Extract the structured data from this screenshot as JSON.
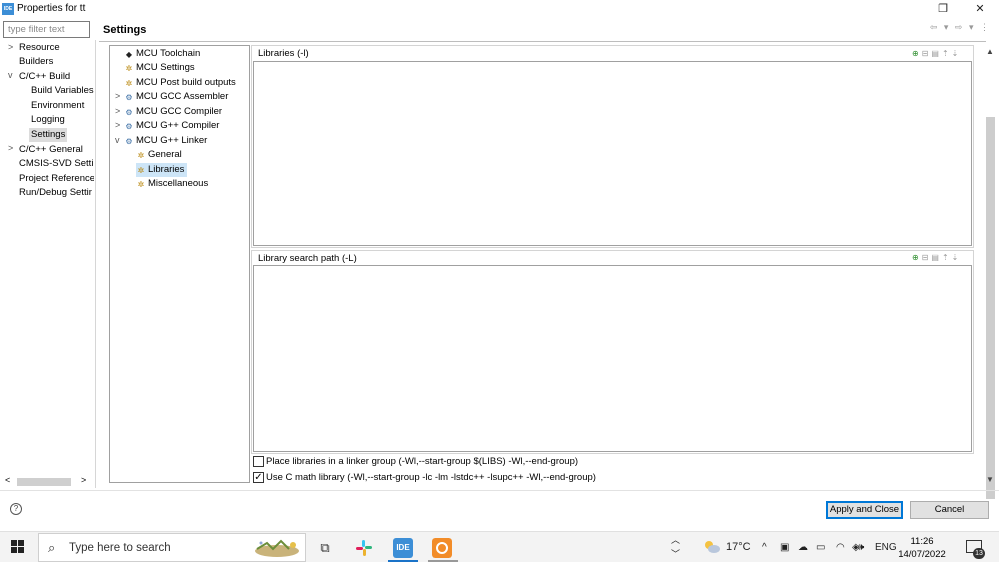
{
  "window": {
    "logo_text": "IDE",
    "title": "Properties for tt",
    "minimize_glyph": "—",
    "restore_glyph": "❐",
    "close_glyph": "✕"
  },
  "nav": {
    "filter_placeholder": "type filter text",
    "items": [
      {
        "label": "Resource",
        "twisty": ">"
      },
      {
        "label": "Builders",
        "twisty": ""
      },
      {
        "label": "C/C++ Build",
        "twisty": "v"
      },
      {
        "label": "Build Variables",
        "twisty": ""
      },
      {
        "label": "Environment",
        "twisty": ""
      },
      {
        "label": "Logging",
        "twisty": ""
      },
      {
        "label": "Settings",
        "twisty": "",
        "selected": true
      },
      {
        "label": "C/C++ General",
        "twisty": ">"
      },
      {
        "label": "CMSIS-SVD Setti",
        "twisty": ""
      },
      {
        "label": "Project Reference",
        "twisty": ""
      },
      {
        "label": "Run/Debug Settir",
        "twisty": ""
      }
    ],
    "scroll_left": "<",
    "scroll_right": ">"
  },
  "page": {
    "title": "Settings",
    "history_icons": "⇦ ▾ ⇨ ▾ ⋮"
  },
  "tool_tree": {
    "items": [
      {
        "label": "MCU Toolchain",
        "twisty": "",
        "icon": "chip-icon"
      },
      {
        "label": "MCU Settings",
        "twisty": "",
        "icon": "cog-icon"
      },
      {
        "label": "MCU Post build outputs",
        "twisty": "",
        "icon": "cog-icon"
      },
      {
        "label": "MCU GCC Assembler",
        "twisty": ">",
        "icon": "gear-icon"
      },
      {
        "label": "MCU GCC Compiler",
        "twisty": ">",
        "icon": "gear-icon"
      },
      {
        "label": "MCU G++ Compiler",
        "twisty": ">",
        "icon": "gear-icon"
      },
      {
        "label": "MCU G++ Linker",
        "twisty": "v",
        "icon": "gear-icon"
      },
      {
        "label": "General",
        "twisty": "",
        "icon": "cog-icon"
      },
      {
        "label": "Libraries",
        "twisty": "",
        "icon": "cog-icon",
        "selected": true
      },
      {
        "label": "Miscellaneous",
        "twisty": "",
        "icon": "cog-icon"
      }
    ]
  },
  "libraries_panel": {
    "label": "Libraries (-l)"
  },
  "search_path_panel": {
    "label": "Library search path (-L)"
  },
  "options": {
    "linker_group_label": "Place libraries in a linker group (-Wl,--start-group $(LIBS) -Wl,--end-group)",
    "linker_group_checked": false,
    "c_math_label": "Use C math library (-Wl,--start-group -lc -lm -lstdc++ -lsupc++ -Wl,--end-group)",
    "c_math_checked": true,
    "check_glyph": "✓"
  },
  "footer": {
    "help_glyph": "?",
    "apply_close_label": "Apply and Close",
    "cancel_label": "Cancel"
  },
  "taskbar": {
    "search_placeholder": "Type here to search",
    "search_glyph": "⌕",
    "task_view_glyph": "⧉",
    "ide_label": "IDE",
    "weather_temp": "17°C",
    "tray_chevron": "^",
    "language": "ENG",
    "time": "11:26",
    "date": "14/07/2022",
    "notification_count": "13"
  },
  "colors": {
    "accent": "#0078d7",
    "tree_selection": "#cde5f7",
    "ide_blue": "#3c8ed6",
    "slack": "#e01e5a",
    "orange_app": "#f28c28"
  }
}
